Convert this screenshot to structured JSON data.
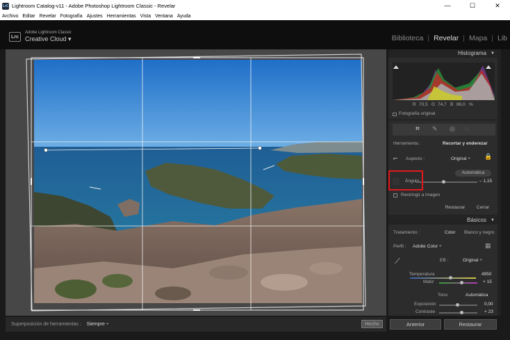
{
  "window": {
    "title": "Lightroom Catalog-v11 - Adobe Photoshop Lightroom Classic - Revelar",
    "minimize": "—",
    "maximize": "☐",
    "close": "✕",
    "icon_text": "LrC"
  },
  "menu": [
    "Archivo",
    "Editar",
    "Revelar",
    "Fotografía",
    "Ajustes",
    "Herramientas",
    "Vista",
    "Ventana",
    "Ayuda"
  ],
  "brand": {
    "logo": "Lrc",
    "line1": "Adobe Lightroom Classic",
    "line2": "Creative Cloud ▾"
  },
  "modules": {
    "library": "Biblioteca",
    "develop": "Revelar",
    "map": "Mapa",
    "more": "Lib"
  },
  "histogram": {
    "title": "Histograma",
    "r_label": "R",
    "r_value": "70,5",
    "g_label": "G",
    "g_value": "74,7",
    "b_label": "B",
    "b_value": "86,0",
    "unit": "%",
    "original_photo": "Fotografía original"
  },
  "crop": {
    "tool_label": "Herramienta :",
    "tool_value": "Recortar y enderezar",
    "aspect_label": "Aspecto :",
    "aspect_value": "Original ÷",
    "auto_button": "Automática",
    "angle_label": "Ángulo",
    "angle_value": "– 1,15",
    "angle_fraction": 0.45,
    "constrain": "Restringir a imagen",
    "reset": "Restaurar",
    "close": "Cerrar"
  },
  "basic": {
    "title": "Básicos",
    "treatment_label": "Tratamiento :",
    "color": "Color",
    "bw": "Blanco y negro",
    "profile_label": "Perfil :",
    "profile_value": "Adobe Color ÷",
    "wb_label": "EB :",
    "wb_value": "Original ÷",
    "temp_label": "Temperatura",
    "temp_value": "4950",
    "tint_label": "Matiz",
    "tint_value": "+ 15",
    "tone_label": "Tono",
    "tone_auto": "Automática",
    "exposure_label": "Exposición",
    "exposure_value": "0,00",
    "contrast_label": "Contraste",
    "contrast_value": "+ 23"
  },
  "toolbar": {
    "overlay_label": "Superposición de herramientas :",
    "overlay_value": "Siempre ÷",
    "done": "Hecho"
  },
  "bottom": {
    "previous": "Anterior",
    "reset": "Restaurar"
  }
}
